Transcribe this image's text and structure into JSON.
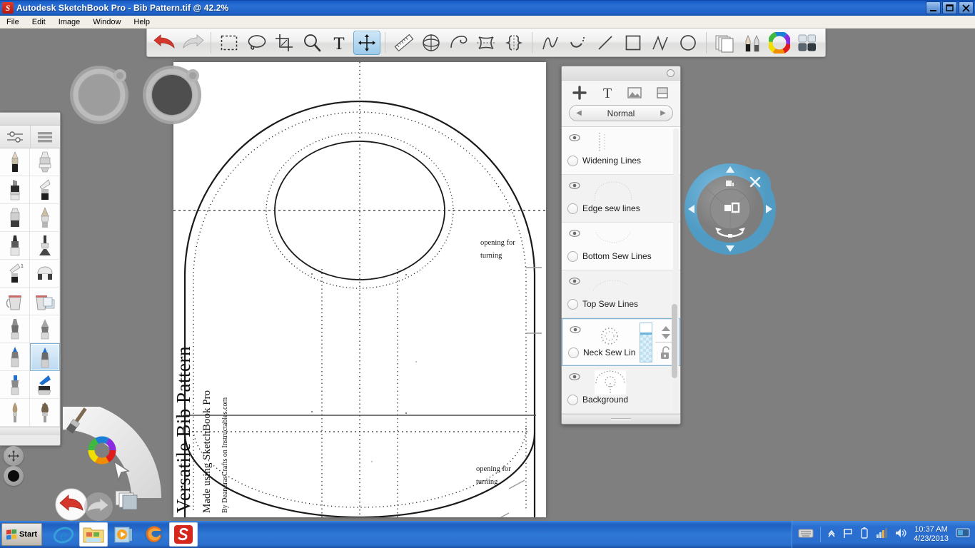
{
  "window": {
    "app_icon": "sketchbook-logo-icon",
    "title": "Autodesk SketchBook Pro - Bib Pattern.tif @ 42.2%",
    "minimize_label": "_",
    "maximize_label": "□",
    "close_label": "✕"
  },
  "menubar": {
    "items": [
      {
        "label": "File",
        "name": "menu-file"
      },
      {
        "label": "Edit",
        "name": "menu-edit"
      },
      {
        "label": "Image",
        "name": "menu-image"
      },
      {
        "label": "Window",
        "name": "menu-window"
      },
      {
        "label": "Help",
        "name": "menu-help"
      }
    ]
  },
  "toolbar": {
    "groups": [
      {
        "buttons": [
          {
            "name": "undo-button",
            "icon": "undo-arrow-icon",
            "label": "Undo",
            "active": false
          },
          {
            "name": "redo-button",
            "icon": "redo-arrow-icon",
            "label": "Redo",
            "active": false
          }
        ]
      },
      {
        "buttons": [
          {
            "name": "rectangle-select-tool",
            "icon": "rectangle-marquee-icon",
            "label": "Rectangle Select",
            "active": false
          },
          {
            "name": "lasso-select-tool",
            "icon": "lasso-icon",
            "label": "Lasso Select",
            "active": false
          },
          {
            "name": "crop-tool",
            "icon": "crop-icon",
            "label": "Crop",
            "active": false
          },
          {
            "name": "zoom-tool",
            "icon": "magnifier-icon",
            "label": "Zoom",
            "active": false
          },
          {
            "name": "text-tool",
            "icon": "text-t-icon",
            "label": "Text",
            "active": false
          },
          {
            "name": "transform-tool",
            "icon": "move-arrows-icon",
            "label": "Transform",
            "active": true
          }
        ]
      },
      {
        "buttons": [
          {
            "name": "ruler-tool",
            "icon": "ruler-icon",
            "label": "Ruler",
            "active": false
          },
          {
            "name": "ellipse-guide-tool",
            "icon": "ellipse-guide-icon",
            "label": "Ellipse Guide",
            "active": false
          },
          {
            "name": "french-curve-tool",
            "icon": "french-curve-icon",
            "label": "French Curve",
            "active": false
          },
          {
            "name": "symmetry-xy-tool",
            "icon": "symmetry-xy-icon",
            "label": "Symmetry X Y",
            "active": false
          },
          {
            "name": "symmetry-y-tool",
            "icon": "symmetry-y-icon",
            "label": "Symmetry Y",
            "active": false
          }
        ]
      },
      {
        "buttons": [
          {
            "name": "predictive-stroke-tool",
            "icon": "squiggle-stroke-icon",
            "label": "Predictive Stroke",
            "active": false
          },
          {
            "name": "steady-stroke-tool",
            "icon": "dotted-curve-icon",
            "label": "Steady Stroke",
            "active": false
          },
          {
            "name": "line-tool",
            "icon": "straight-line-icon",
            "label": "Straight Line",
            "active": false
          },
          {
            "name": "rectangle-shape-tool",
            "icon": "square-shape-icon",
            "label": "Rectangle",
            "active": false
          },
          {
            "name": "polyline-tool",
            "icon": "polyline-icon",
            "label": "Polyline",
            "active": false
          },
          {
            "name": "ellipse-shape-tool",
            "icon": "circle-shape-icon",
            "label": "Ellipse",
            "active": false
          }
        ]
      },
      {
        "buttons": [
          {
            "name": "layers-panel-button",
            "icon": "layers-stack-icon",
            "label": "Layer Editor",
            "active": false
          },
          {
            "name": "brush-palette-button",
            "icon": "pencils-icon",
            "label": "Brush Palette",
            "active": false
          },
          {
            "name": "color-wheel-button",
            "icon": "color-wheel-icon",
            "label": "Color Wheel",
            "active": false
          },
          {
            "name": "color-swatches-button",
            "icon": "swatch-grid-icon",
            "label": "Color Swatches",
            "active": false
          }
        ]
      }
    ]
  },
  "brush_palette": {
    "tabs": [
      {
        "name": "brush-properties-tab",
        "icon": "sliders-icon",
        "label": "Brush Properties"
      },
      {
        "name": "brush-library-tab",
        "icon": "list-lines-icon",
        "label": "Brush Library"
      }
    ],
    "brushes": [
      {
        "name": "brush-pencil",
        "label": "Pencil",
        "selected": false
      },
      {
        "name": "brush-chisel-marker",
        "label": "Chisel Tip Marker",
        "selected": false
      },
      {
        "name": "brush-marker",
        "label": "Marker",
        "selected": false
      },
      {
        "name": "brush-flat-marker",
        "label": "Flat Marker",
        "selected": false
      },
      {
        "name": "brush-eraser-hard",
        "label": "Hard Eraser",
        "selected": false
      },
      {
        "name": "brush-soft-pen",
        "label": "Soft Pen",
        "selected": false
      },
      {
        "name": "brush-airbrush",
        "label": "Airbrush",
        "selected": false
      },
      {
        "name": "brush-spray",
        "label": "Spray",
        "selected": false
      },
      {
        "name": "brush-flat-eraser",
        "label": "Flat Eraser",
        "selected": false
      },
      {
        "name": "brush-block-eraser",
        "label": "Block Eraser",
        "selected": false
      },
      {
        "name": "brush-paint-bucket",
        "label": "Paint Bucket",
        "selected": false
      },
      {
        "name": "brush-layer-fill",
        "label": "Layer Fill",
        "selected": false
      },
      {
        "name": "brush-gray-pen",
        "label": "Gray Pen",
        "selected": false
      },
      {
        "name": "brush-gray-sharp-pen",
        "label": "Sharp Pen",
        "selected": false
      },
      {
        "name": "brush-blue-pen",
        "label": "Blue Pen",
        "selected": false
      },
      {
        "name": "brush-blue-sharp-pen",
        "label": "Blue Sharp Pen",
        "selected": true
      },
      {
        "name": "brush-blue-marker",
        "label": "Blue Marker",
        "selected": false
      },
      {
        "name": "brush-blue-wide-marker",
        "label": "Blue Wide Marker",
        "selected": false
      },
      {
        "name": "brush-soft-brush",
        "label": "Soft Brush",
        "selected": false
      },
      {
        "name": "brush-bristle-brush",
        "label": "Bristle Brush",
        "selected": false
      }
    ]
  },
  "lagoon": {
    "items": [
      {
        "name": "lagoon-brush-button",
        "icon": "paintbrush-icon",
        "label": "Brush"
      },
      {
        "name": "lagoon-color-button",
        "icon": "color-wheel-icon",
        "label": "Color"
      },
      {
        "name": "lagoon-select-button",
        "icon": "cursor-arrow-icon",
        "label": "Selection"
      },
      {
        "name": "lagoon-layers-button",
        "icon": "layers-stack-icon",
        "label": "Layers"
      },
      {
        "name": "lagoon-undo-button",
        "icon": "undo-arrow-icon",
        "label": "Undo"
      },
      {
        "name": "lagoon-redo-button",
        "icon": "redo-arrow-icon",
        "label": "Redo"
      }
    ],
    "pucks": [
      {
        "name": "brush-size-puck",
        "icon": "move-arrows-icon",
        "label": "Brush Size Puck"
      },
      {
        "name": "brush-color-puck",
        "icon": "filled-circle-icon",
        "label": "Color Puck"
      }
    ]
  },
  "canvas_pucks": [
    {
      "name": "brush-size-canvas-puck",
      "label": "Brush Size"
    },
    {
      "name": "brush-opacity-canvas-puck",
      "label": "Brush Opacity"
    }
  ],
  "canvas": {
    "title_text": "Versatile Bib Pattern",
    "subtitle_text": "Made using SketchBook Pro",
    "credit_text": "By DeandrasCrafts on Instructables.com",
    "annotations": [
      {
        "name": "annotation-opening-top",
        "line1": "opening for",
        "line2": "turning"
      },
      {
        "name": "annotation-opening-bottom",
        "line1": "opening for",
        "line2": "turning"
      }
    ]
  },
  "layers_panel": {
    "title": "",
    "gear_icon": "gear-circle-icon",
    "tools": [
      {
        "name": "add-layer-button",
        "icon": "plus-icon",
        "label": "Add Layer"
      },
      {
        "name": "add-text-layer-button",
        "icon": "text-t-icon",
        "label": "Add Text"
      },
      {
        "name": "add-image-layer-button",
        "icon": "image-icon",
        "label": "Add Image"
      },
      {
        "name": "add-note-layer-button",
        "icon": "note-icon",
        "label": "Add Note"
      }
    ],
    "blend_mode": {
      "prev_label": "◀",
      "value": "Normal",
      "next_label": "▶"
    },
    "layers": [
      {
        "name": "layer-widening-lines",
        "label": "Widening Lines",
        "visible": true,
        "selected": false
      },
      {
        "name": "layer-edge-sew-lines",
        "label": "Edge sew lines",
        "visible": true,
        "selected": false
      },
      {
        "name": "layer-bottom-sew-lines",
        "label": "Bottom Sew Lines",
        "visible": true,
        "selected": false
      },
      {
        "name": "layer-top-sew-lines",
        "label": "Top Sew Lines",
        "visible": true,
        "selected": false
      },
      {
        "name": "layer-neck-sew-lines",
        "label": "Neck Sew Lin",
        "visible": true,
        "selected": true
      },
      {
        "name": "layer-background",
        "label": "Background",
        "visible": true,
        "selected": false
      }
    ],
    "selected_layer_controls": {
      "opacity_slider": "layer-opacity-slider",
      "stepper_icon": "up-down-arrows-icon",
      "lock_icon": "unlocked-padlock-icon"
    }
  },
  "transform_puck": {
    "name": "transform-puck",
    "close_label": "✕",
    "buttons": [
      {
        "name": "puck-up-button",
        "icon": "chevron-up-icon"
      },
      {
        "name": "puck-down-button",
        "icon": "chevron-down-icon"
      },
      {
        "name": "puck-left-button",
        "icon": "chevron-left-icon"
      },
      {
        "name": "puck-right-button",
        "icon": "chevron-right-icon"
      },
      {
        "name": "puck-scale-button",
        "icon": "scale-icon"
      },
      {
        "name": "puck-rotate-button",
        "icon": "rotate-arc-icon"
      },
      {
        "name": "puck-center-button",
        "icon": "distort-square-icon"
      }
    ]
  },
  "taskbar": {
    "start_label": "Start",
    "quick_launch": [
      {
        "name": "taskbar-internet-explorer",
        "label": "Internet Explorer",
        "active": false
      },
      {
        "name": "taskbar-windows-explorer",
        "label": "Windows Explorer",
        "active": true
      },
      {
        "name": "taskbar-media-player",
        "label": "Windows Media Player",
        "active": false
      },
      {
        "name": "taskbar-firefox",
        "label": "Mozilla Firefox",
        "active": false
      },
      {
        "name": "taskbar-sketchbook",
        "label": "Autodesk SketchBook Pro",
        "active": true
      }
    ],
    "tray": {
      "icons": [
        {
          "name": "tray-keyboard-icon",
          "label": "Tablet Input"
        },
        {
          "name": "tray-expand-icon",
          "label": "Show hidden icons"
        },
        {
          "name": "tray-flag-icon",
          "label": "Action Center"
        },
        {
          "name": "tray-battery-icon",
          "label": "Battery"
        },
        {
          "name": "tray-network-icon",
          "label": "Network"
        },
        {
          "name": "tray-volume-icon",
          "label": "Volume"
        }
      ],
      "time": "10:37 AM",
      "date": "4/23/2013",
      "show_desktop": "show-desktop-button"
    }
  },
  "colors": {
    "titlebar_blue": "#1d5fc4",
    "taskbar_blue": "#2b6fce",
    "accent_selected": "#86b4d4",
    "puck_blue": "#5ba4cf",
    "desktop_gray": "#7f7f7f"
  }
}
